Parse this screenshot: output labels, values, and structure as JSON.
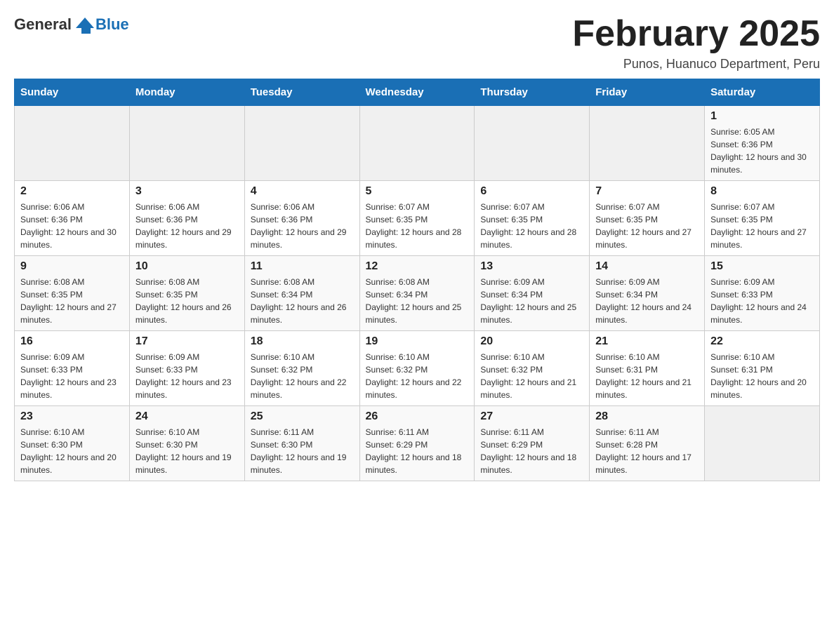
{
  "logo": {
    "general": "General",
    "blue": "Blue"
  },
  "title": "February 2025",
  "subtitle": "Punos, Huanuco Department, Peru",
  "weekdays": [
    "Sunday",
    "Monday",
    "Tuesday",
    "Wednesday",
    "Thursday",
    "Friday",
    "Saturday"
  ],
  "weeks": [
    [
      {
        "day": "",
        "info": ""
      },
      {
        "day": "",
        "info": ""
      },
      {
        "day": "",
        "info": ""
      },
      {
        "day": "",
        "info": ""
      },
      {
        "day": "",
        "info": ""
      },
      {
        "day": "",
        "info": ""
      },
      {
        "day": "1",
        "info": "Sunrise: 6:05 AM\nSunset: 6:36 PM\nDaylight: 12 hours and 30 minutes."
      }
    ],
    [
      {
        "day": "2",
        "info": "Sunrise: 6:06 AM\nSunset: 6:36 PM\nDaylight: 12 hours and 30 minutes."
      },
      {
        "day": "3",
        "info": "Sunrise: 6:06 AM\nSunset: 6:36 PM\nDaylight: 12 hours and 29 minutes."
      },
      {
        "day": "4",
        "info": "Sunrise: 6:06 AM\nSunset: 6:36 PM\nDaylight: 12 hours and 29 minutes."
      },
      {
        "day": "5",
        "info": "Sunrise: 6:07 AM\nSunset: 6:35 PM\nDaylight: 12 hours and 28 minutes."
      },
      {
        "day": "6",
        "info": "Sunrise: 6:07 AM\nSunset: 6:35 PM\nDaylight: 12 hours and 28 minutes."
      },
      {
        "day": "7",
        "info": "Sunrise: 6:07 AM\nSunset: 6:35 PM\nDaylight: 12 hours and 27 minutes."
      },
      {
        "day": "8",
        "info": "Sunrise: 6:07 AM\nSunset: 6:35 PM\nDaylight: 12 hours and 27 minutes."
      }
    ],
    [
      {
        "day": "9",
        "info": "Sunrise: 6:08 AM\nSunset: 6:35 PM\nDaylight: 12 hours and 27 minutes."
      },
      {
        "day": "10",
        "info": "Sunrise: 6:08 AM\nSunset: 6:35 PM\nDaylight: 12 hours and 26 minutes."
      },
      {
        "day": "11",
        "info": "Sunrise: 6:08 AM\nSunset: 6:34 PM\nDaylight: 12 hours and 26 minutes."
      },
      {
        "day": "12",
        "info": "Sunrise: 6:08 AM\nSunset: 6:34 PM\nDaylight: 12 hours and 25 minutes."
      },
      {
        "day": "13",
        "info": "Sunrise: 6:09 AM\nSunset: 6:34 PM\nDaylight: 12 hours and 25 minutes."
      },
      {
        "day": "14",
        "info": "Sunrise: 6:09 AM\nSunset: 6:34 PM\nDaylight: 12 hours and 24 minutes."
      },
      {
        "day": "15",
        "info": "Sunrise: 6:09 AM\nSunset: 6:33 PM\nDaylight: 12 hours and 24 minutes."
      }
    ],
    [
      {
        "day": "16",
        "info": "Sunrise: 6:09 AM\nSunset: 6:33 PM\nDaylight: 12 hours and 23 minutes."
      },
      {
        "day": "17",
        "info": "Sunrise: 6:09 AM\nSunset: 6:33 PM\nDaylight: 12 hours and 23 minutes."
      },
      {
        "day": "18",
        "info": "Sunrise: 6:10 AM\nSunset: 6:32 PM\nDaylight: 12 hours and 22 minutes."
      },
      {
        "day": "19",
        "info": "Sunrise: 6:10 AM\nSunset: 6:32 PM\nDaylight: 12 hours and 22 minutes."
      },
      {
        "day": "20",
        "info": "Sunrise: 6:10 AM\nSunset: 6:32 PM\nDaylight: 12 hours and 21 minutes."
      },
      {
        "day": "21",
        "info": "Sunrise: 6:10 AM\nSunset: 6:31 PM\nDaylight: 12 hours and 21 minutes."
      },
      {
        "day": "22",
        "info": "Sunrise: 6:10 AM\nSunset: 6:31 PM\nDaylight: 12 hours and 20 minutes."
      }
    ],
    [
      {
        "day": "23",
        "info": "Sunrise: 6:10 AM\nSunset: 6:30 PM\nDaylight: 12 hours and 20 minutes."
      },
      {
        "day": "24",
        "info": "Sunrise: 6:10 AM\nSunset: 6:30 PM\nDaylight: 12 hours and 19 minutes."
      },
      {
        "day": "25",
        "info": "Sunrise: 6:11 AM\nSunset: 6:30 PM\nDaylight: 12 hours and 19 minutes."
      },
      {
        "day": "26",
        "info": "Sunrise: 6:11 AM\nSunset: 6:29 PM\nDaylight: 12 hours and 18 minutes."
      },
      {
        "day": "27",
        "info": "Sunrise: 6:11 AM\nSunset: 6:29 PM\nDaylight: 12 hours and 18 minutes."
      },
      {
        "day": "28",
        "info": "Sunrise: 6:11 AM\nSunset: 6:28 PM\nDaylight: 12 hours and 17 minutes."
      },
      {
        "day": "",
        "info": ""
      }
    ]
  ]
}
